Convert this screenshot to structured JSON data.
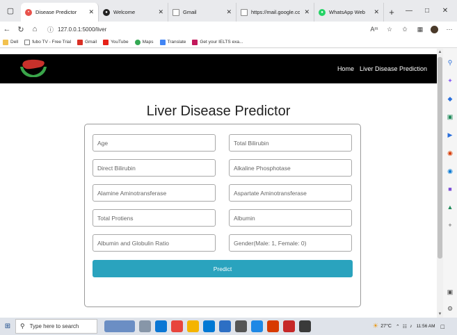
{
  "browser": {
    "tabs": [
      {
        "label": "Disease Predictor",
        "active": true,
        "icon": "site-favicon",
        "color": "#e8534c"
      },
      {
        "label": "Welcome",
        "active": false,
        "icon": "github-favicon",
        "color": "#222222"
      },
      {
        "label": "Gmail",
        "active": false,
        "icon": "page-icon",
        "color": "#888888"
      },
      {
        "label": "https://mail.google.com/",
        "active": false,
        "icon": "page-icon",
        "color": "#888888"
      },
      {
        "label": "WhatsApp Web",
        "active": false,
        "icon": "whatsapp-favicon",
        "color": "#25d366"
      }
    ],
    "address": "127.0.0.1:5000/liver",
    "bookmarks": [
      {
        "label": "Dell",
        "icon": "folder-icon",
        "color": "#f2c14e"
      },
      {
        "label": "fubo TV - Free Trial",
        "icon": "page-icon",
        "color": "#ffffff"
      },
      {
        "label": "Gmail",
        "icon": "gmail-icon",
        "color": "#d93025"
      },
      {
        "label": "YouTube",
        "icon": "youtube-icon",
        "color": "#e62117"
      },
      {
        "label": "Maps",
        "icon": "map-pin-icon",
        "color": "#34a853"
      },
      {
        "label": "Translate",
        "icon": "translate-icon",
        "color": "#4285f4"
      },
      {
        "label": "Get your IELTS exa...",
        "icon": "ielts-icon",
        "color": "#c2185b"
      }
    ]
  },
  "site": {
    "nav": {
      "home": "Home",
      "liver": "Liver Disease Prediction"
    },
    "title": "Liver Disease Predictor",
    "fields": [
      {
        "placeholder": "Age",
        "name": "age-input"
      },
      {
        "placeholder": "Total Bilirubin",
        "name": "total-bilirubin-input"
      },
      {
        "placeholder": "Direct Bilirubin",
        "name": "direct-bilirubin-input"
      },
      {
        "placeholder": "Alkaline Phosphotase",
        "name": "alkaline-phosphotase-input"
      },
      {
        "placeholder": "Alamine Aminotransferase",
        "name": "alamine-aminotransferase-input"
      },
      {
        "placeholder": "Aspartate Aminotransferase",
        "name": "aspartate-aminotransferase-input"
      },
      {
        "placeholder": "Total Protiens",
        "name": "total-protiens-input"
      },
      {
        "placeholder": "Albumin",
        "name": "albumin-input"
      },
      {
        "placeholder": "Albumin and Globulin Ratio",
        "name": "albumin-globulin-ratio-input"
      },
      {
        "placeholder": "Gender(Male: 1, Female: 0)",
        "name": "gender-input"
      }
    ],
    "predict_label": "Predict",
    "accent": "#2aa3be"
  },
  "taskbar": {
    "search_placeholder": "Type here to search",
    "weather": "27°C",
    "time": "11:56 AM"
  }
}
